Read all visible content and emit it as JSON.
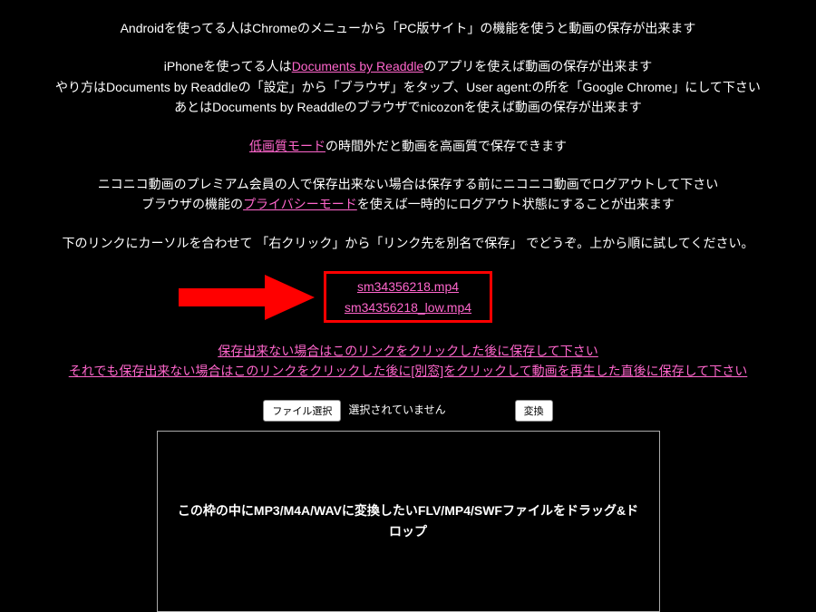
{
  "para1": {
    "text": "Androidを使ってる人はChromeのメニューから「PC版サイト」の機能を使うと動画の保存が出来ます"
  },
  "para2": {
    "prefix": "iPhoneを使ってる人は",
    "link": "Documents by Readdle",
    "suffix": "のアプリを使えば動画の保存が出来ます",
    "line2": "やり方はDocuments by Readdleの「設定」から「ブラウザ」をタップ、User agent:の所を「Google Chrome」にして下さい",
    "line3": "あとはDocuments by Readdleのブラウザでnicozonを使えば動画の保存が出来ます"
  },
  "para3": {
    "link": "低画質モード",
    "suffix": "の時間外だと動画を高画質で保存できます"
  },
  "para4": {
    "text": "ニコニコ動画のプレミアム会員の人で保存出来ない場合は保存する前にニコニコ動画でログアウトして下さい",
    "prefix2": "ブラウザの機能の",
    "link": "プライバシーモード",
    "suffix2": "を使えば一時的にログアウト状態にすることが出来ます"
  },
  "para5": {
    "text": "下のリンクにカーソルを合わせて 「右クリック」から「リンク先を別名で保存」 でどうぞ。上から順に試してください。"
  },
  "downloads": {
    "link1": "sm34356218.mp4",
    "link2": "sm34356218_low.mp4"
  },
  "fallback": {
    "link1": "保存出来ない場合はこのリンクをクリックした後に保存して下さい",
    "link2": "それでも保存出来ない場合はこのリンクをクリックした後に[別窓]をクリックして動画を再生した直後に保存して下さい"
  },
  "fileRow": {
    "selectBtn": "ファイル選択",
    "status": "選択されていません",
    "convertBtn": "変換"
  },
  "dropzone": {
    "text": "この枠の中にMP3/M4A/WAVに変換したいFLV/MP4/SWFファイルをドラッグ&ドロップ"
  }
}
